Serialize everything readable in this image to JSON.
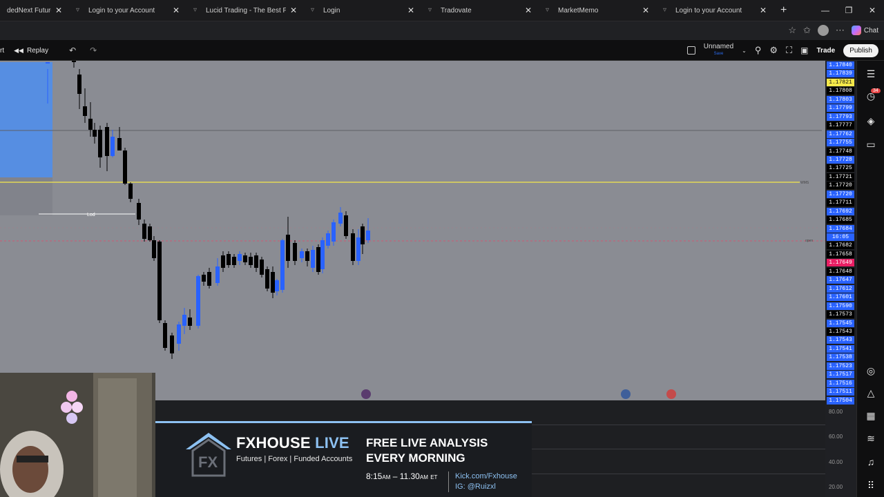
{
  "browser": {
    "tabs": [
      {
        "title": "dedNext Futures Hel"
      },
      {
        "title": "Login to your Account"
      },
      {
        "title": "Lucid Trading - The Best Prop Fi"
      },
      {
        "title": "Login"
      },
      {
        "title": "Tradovate"
      },
      {
        "title": "MarketMemo"
      },
      {
        "title": "Login to your Account"
      }
    ],
    "chat_label": "Chat"
  },
  "toolbar": {
    "cut_label": "rt",
    "replay_label": "Replay",
    "layout_name": "Unnamed",
    "layout_status": "Save",
    "trade_label": "Trade",
    "publish_label": "Publish"
  },
  "chart": {
    "lod_label": "Lod",
    "line_label_right": "WMS",
    "open_label": "open",
    "countdown": "16:05",
    "price_labels": [
      {
        "v": "1.17840",
        "bg": "#2962ff",
        "fg": "#ffffff"
      },
      {
        "v": "1.17839",
        "bg": "#2962ff",
        "fg": "#ffffff"
      },
      {
        "v": "1.17821",
        "bg": "#f5e94a",
        "fg": "#111111"
      },
      {
        "v": "1.17808",
        "bg": "#000000",
        "fg": "#ffffff"
      },
      {
        "v": "1.17803",
        "bg": "#2962ff",
        "fg": "#ffffff"
      },
      {
        "v": "1.17799",
        "bg": "#2962ff",
        "fg": "#ffffff"
      },
      {
        "v": "1.17793",
        "bg": "#2962ff",
        "fg": "#ffffff"
      },
      {
        "v": "1.17777",
        "bg": "#000000",
        "fg": "#ffffff"
      },
      {
        "v": "1.17762",
        "bg": "#2962ff",
        "fg": "#ffffff"
      },
      {
        "v": "1.17755",
        "bg": "#2962ff",
        "fg": "#ffffff"
      },
      {
        "v": "1.17748",
        "bg": "#000000",
        "fg": "#ffffff"
      },
      {
        "v": "1.17728",
        "bg": "#2962ff",
        "fg": "#ffffff"
      },
      {
        "v": "1.17725",
        "bg": "#000000",
        "fg": "#ffffff"
      },
      {
        "v": "1.17721",
        "bg": "#000000",
        "fg": "#ffffff"
      },
      {
        "v": "1.17720",
        "bg": "#000000",
        "fg": "#ffffff"
      },
      {
        "v": "1.17720",
        "bg": "#2962ff",
        "fg": "#ffffff"
      },
      {
        "v": "1.17711",
        "bg": "#000000",
        "fg": "#ffffff"
      },
      {
        "v": "1.17692",
        "bg": "#2962ff",
        "fg": "#ffffff"
      },
      {
        "v": "1.17685",
        "bg": "#000000",
        "fg": "#ffffff"
      },
      {
        "v": "1.17684",
        "bg": "#2962ff",
        "fg": "#ffffff"
      },
      {
        "v": "16:05",
        "bg": "#2962ff",
        "fg": "#ffffff"
      },
      {
        "v": "1.17682",
        "bg": "#000000",
        "fg": "#ffffff"
      },
      {
        "v": "1.17658",
        "bg": "#000000",
        "fg": "#ffffff"
      },
      {
        "v": "1.17649",
        "bg": "#e91e63",
        "fg": "#ffffff"
      },
      {
        "v": "1.17648",
        "bg": "#000000",
        "fg": "#ffffff"
      },
      {
        "v": "1.17647",
        "bg": "#2962ff",
        "fg": "#ffffff"
      },
      {
        "v": "1.17612",
        "bg": "#2962ff",
        "fg": "#ffffff"
      },
      {
        "v": "1.17601",
        "bg": "#2962ff",
        "fg": "#ffffff"
      },
      {
        "v": "1.17590",
        "bg": "#2962ff",
        "fg": "#ffffff"
      },
      {
        "v": "1.17573",
        "bg": "#000000",
        "fg": "#ffffff"
      },
      {
        "v": "1.17545",
        "bg": "#2962ff",
        "fg": "#ffffff"
      },
      {
        "v": "1.17543",
        "bg": "#000000",
        "fg": "#ffffff"
      },
      {
        "v": "1.17543",
        "bg": "#2962ff",
        "fg": "#ffffff"
      },
      {
        "v": "1.17541",
        "bg": "#2962ff",
        "fg": "#ffffff"
      },
      {
        "v": "1.17538",
        "bg": "#2962ff",
        "fg": "#ffffff"
      },
      {
        "v": "1.17523",
        "bg": "#2962ff",
        "fg": "#ffffff"
      },
      {
        "v": "1.17517",
        "bg": "#2962ff",
        "fg": "#ffffff"
      },
      {
        "v": "1.17516",
        "bg": "#2962ff",
        "fg": "#ffffff"
      },
      {
        "v": "1.17511",
        "bg": "#2962ff",
        "fg": "#ffffff"
      },
      {
        "v": "1.17504",
        "bg": "#2962ff",
        "fg": "#ffffff"
      }
    ],
    "sub_levels": [
      "80.00",
      "60.00",
      "40.00",
      "20.00"
    ]
  },
  "overlay": {
    "brand": "FXHOUSE",
    "brand_live": "LIVE",
    "tagline": "Futures | Forex | Funded Accounts",
    "headline_1": "FREE LIVE ANALYSIS",
    "headline_2": "EVERY MORNING",
    "time_start": "8:15",
    "time_start_ampm": "AM",
    "time_end": "11.30",
    "time_end_ampm": "AM",
    "time_zone": "ET",
    "link_1": "Kick.com/Fxhouse",
    "link_2": "IG: @Ruizxl"
  },
  "colors": {
    "chart_bg": "#8a8c93",
    "bull": "#2962ff",
    "bear": "#000000",
    "accent": "#8dc1f2"
  }
}
